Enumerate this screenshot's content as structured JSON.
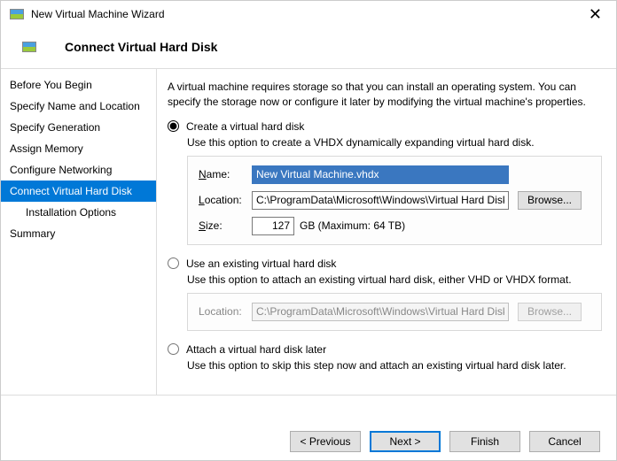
{
  "window": {
    "title": "New Virtual Machine Wizard"
  },
  "header": {
    "title": "Connect Virtual Hard Disk"
  },
  "sidebar": {
    "items": [
      {
        "label": "Before You Begin"
      },
      {
        "label": "Specify Name and Location"
      },
      {
        "label": "Specify Generation"
      },
      {
        "label": "Assign Memory"
      },
      {
        "label": "Configure Networking"
      },
      {
        "label": "Connect Virtual Hard Disk"
      },
      {
        "label": "Installation Options"
      },
      {
        "label": "Summary"
      }
    ]
  },
  "content": {
    "intro": "A virtual machine requires storage so that you can install an operating system. You can specify the storage now or configure it later by modifying the virtual machine's properties.",
    "create": {
      "label": "Create a virtual hard disk",
      "desc": "Use this option to create a VHDX dynamically expanding virtual hard disk.",
      "name_label": "Name:",
      "name_value": "New Virtual Machine.vhdx",
      "location_label": "Location:",
      "location_value": "C:\\ProgramData\\Microsoft\\Windows\\Virtual Hard Disks\\",
      "browse": "Browse...",
      "size_label": "Size:",
      "size_value": "127",
      "size_unit": "GB (Maximum: 64 TB)"
    },
    "existing": {
      "label": "Use an existing virtual hard disk",
      "desc": "Use this option to attach an existing virtual hard disk, either VHD or VHDX format.",
      "location_label": "Location:",
      "location_value": "C:\\ProgramData\\Microsoft\\Windows\\Virtual Hard Disks\\",
      "browse": "Browse..."
    },
    "later": {
      "label": "Attach a virtual hard disk later",
      "desc": "Use this option to skip this step now and attach an existing virtual hard disk later."
    }
  },
  "footer": {
    "previous": "< Previous",
    "next": "Next >",
    "finish": "Finish",
    "cancel": "Cancel"
  }
}
